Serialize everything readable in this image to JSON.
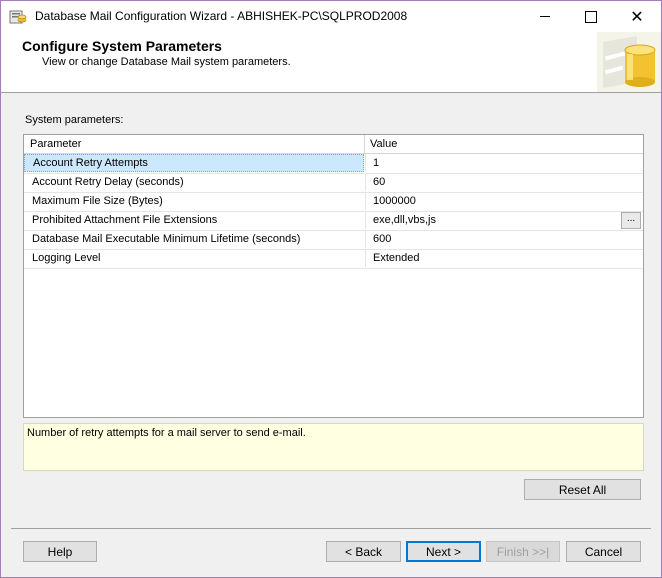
{
  "window": {
    "title": "Database Mail Configuration Wizard - ABHISHEK-PC\\SQLPROD2008",
    "minimize_icon": "minimize-icon",
    "maximize_icon": "maximize-icon",
    "close_icon": "close-icon",
    "close_glyph": "✕"
  },
  "banner": {
    "title": "Configure System Parameters",
    "subtitle": "View or change Database Mail system parameters."
  },
  "section_label": "System parameters:",
  "grid": {
    "columns": [
      "Parameter",
      "Value"
    ],
    "rows": [
      {
        "param": "Account Retry Attempts",
        "value": "1",
        "selected": true
      },
      {
        "param": "Account Retry Delay (seconds)",
        "value": "60"
      },
      {
        "param": "Maximum File Size (Bytes)",
        "value": "1000000"
      },
      {
        "param": "Prohibited Attachment File Extensions",
        "value": "exe,dll,vbs,js",
        "has_button": true
      },
      {
        "param": "Database Mail Executable Minimum Lifetime (seconds)",
        "value": "600"
      },
      {
        "param": "Logging Level",
        "value": "Extended"
      }
    ],
    "ellipsis_label": "..."
  },
  "description": "Number of retry attempts for a mail server to send e-mail.",
  "buttons": {
    "reset_all": "Reset All",
    "help": "Help",
    "back": "< Back",
    "next": "Next >",
    "finish": "Finish >>|",
    "cancel": "Cancel"
  },
  "colors": {
    "selection": "#cce8ff",
    "description_bg": "#ffffe1",
    "accent": "#0078d7"
  }
}
